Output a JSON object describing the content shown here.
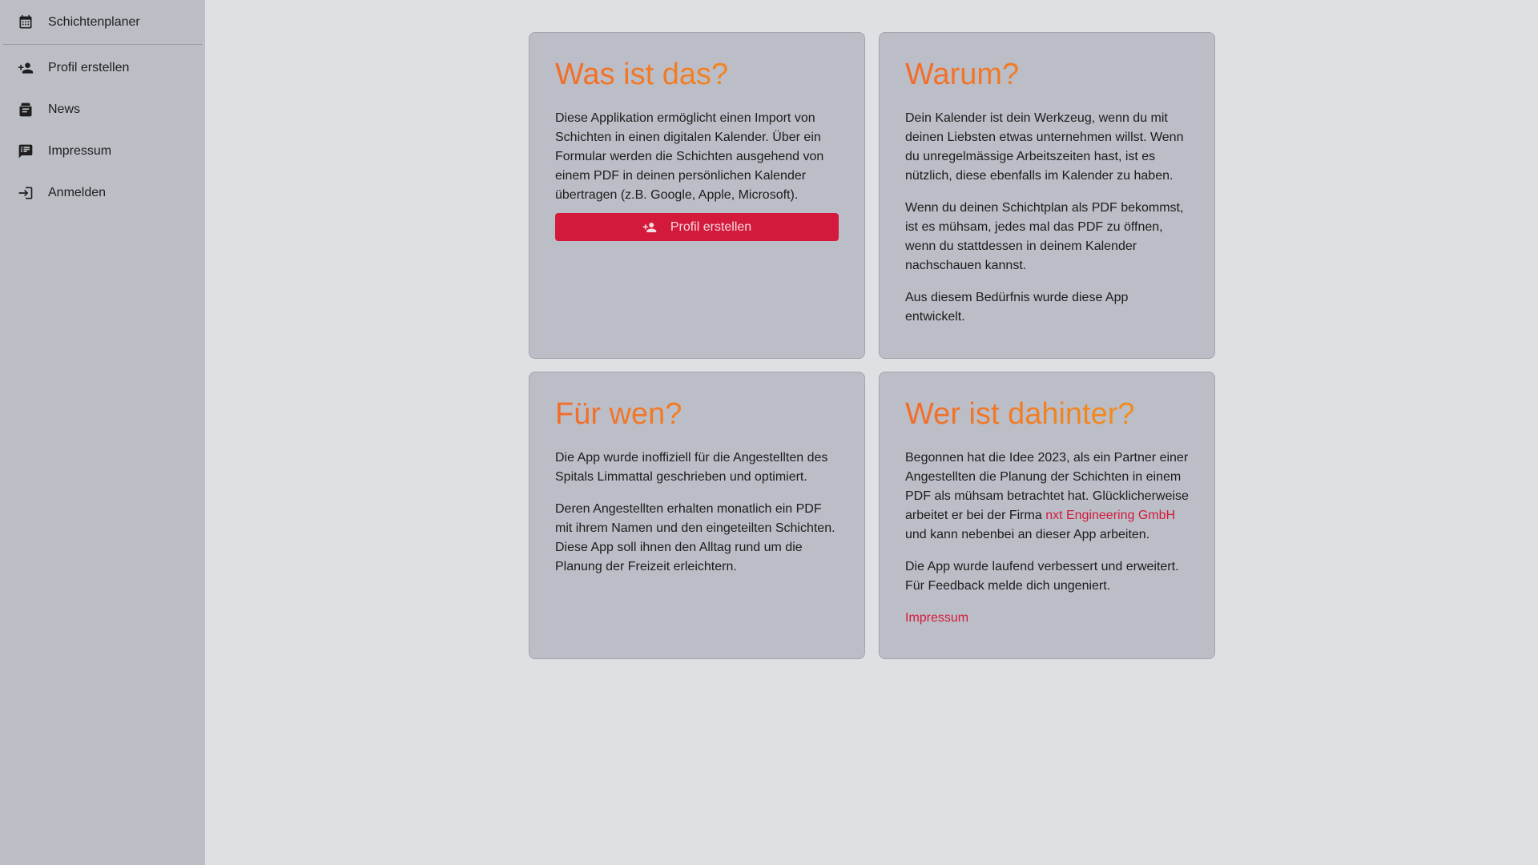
{
  "sidebar": {
    "brand": {
      "icon": "calendar-icon",
      "label": "Schichtenplaner"
    },
    "items": [
      {
        "icon": "person-add-icon",
        "label": "Profil erstellen"
      },
      {
        "icon": "news-mail-icon",
        "label": "News"
      },
      {
        "icon": "list-note-icon",
        "label": "Impressum"
      },
      {
        "icon": "login-icon",
        "label": "Anmelden"
      }
    ]
  },
  "cards": {
    "what": {
      "title": "Was ist das?",
      "p1": "Diese Applikation ermöglicht einen Import von Schichten in einen digitalen Kalender. Über ein Formular werden die Schichten ausgehend von einem PDF in deinen persönlichen Kalender übertragen (z.B. Google, Apple, Microsoft).",
      "button_label": "Profil erstellen",
      "button_icon": "person-add-icon"
    },
    "why": {
      "title": "Warum?",
      "p1": "Dein Kalender ist dein Werkzeug, wenn du mit deinen Liebsten etwas unternehmen willst. Wenn du unregelmässige Arbeitszeiten hast, ist es nützlich, diese ebenfalls im Kalender zu haben.",
      "p2": "Wenn du deinen Schichtplan als PDF bekommst, ist es mühsam, jedes mal das PDF zu öffnen, wenn du stattdessen in deinem Kalender nachschauen kannst.",
      "p3": "Aus diesem Bedürfnis wurde diese App entwickelt."
    },
    "who_for": {
      "title": "Für wen?",
      "p1": "Die App wurde inoffiziell für die Angestellten des Spitals Limmattal geschrieben und optimiert.",
      "p2": "Deren Angestellten erhalten monatlich ein PDF mit ihrem Namen und den eingeteilten Schichten. Diese App soll ihnen den Alltag rund um die Planung der Freizeit erleichtern."
    },
    "who_behind": {
      "title": "Wer ist dahinter?",
      "p1_before": "Begonnen hat die Idee 2023, als ein Partner einer Angestellten die Planung der Schichten in einem PDF als mühsam betrachtet hat. Glücklicherweise arbeitet er bei der Firma ",
      "p1_link": "nxt Engineering GmbH",
      "p1_after": " und kann nebenbei an dieser App arbeiten.",
      "p2": "Die App wurde laufend verbessert und erweitert. Für Feedback melde dich ungeniert.",
      "impressum_link": "Impressum"
    }
  },
  "colors": {
    "title_gradient_start": "#f26b2a",
    "title_gradient_end": "#f0961c",
    "accent": "#d41a3c",
    "sidebar_bg": "#bcbec6",
    "page_bg": "#dfe0e3"
  }
}
